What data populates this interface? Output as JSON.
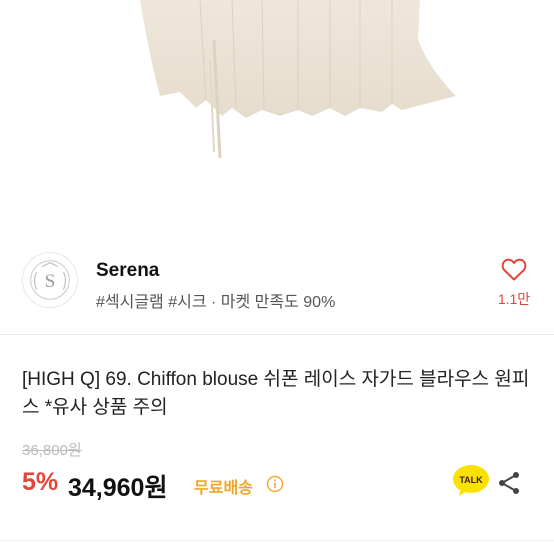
{
  "product_image": {
    "alt": "chiffon-blouse-photo"
  },
  "seller": {
    "name": "Serena",
    "tags": "#섹시글램 #시크 · 마켓 만족도 90%",
    "logo_letter": "S",
    "like_count": "1.1만"
  },
  "product": {
    "title": "[HIGH Q] 69. Chiffon blouse 쉬폰 레이스 자가드 블라우스 원피스 *유사 상품 주의",
    "original_price": "36,800원",
    "discount": "5%",
    "sale_price": "34,960원",
    "shipping": "무료배송"
  },
  "actions": {
    "talk_label": "TALK"
  },
  "colors": {
    "accent_red": "#e4453a",
    "shipping_orange": "#f0a62a",
    "talk_yellow": "#fae100"
  },
  "icons": [
    "heart-icon",
    "info-icon",
    "kakao-talk-icon",
    "share-icon"
  ]
}
